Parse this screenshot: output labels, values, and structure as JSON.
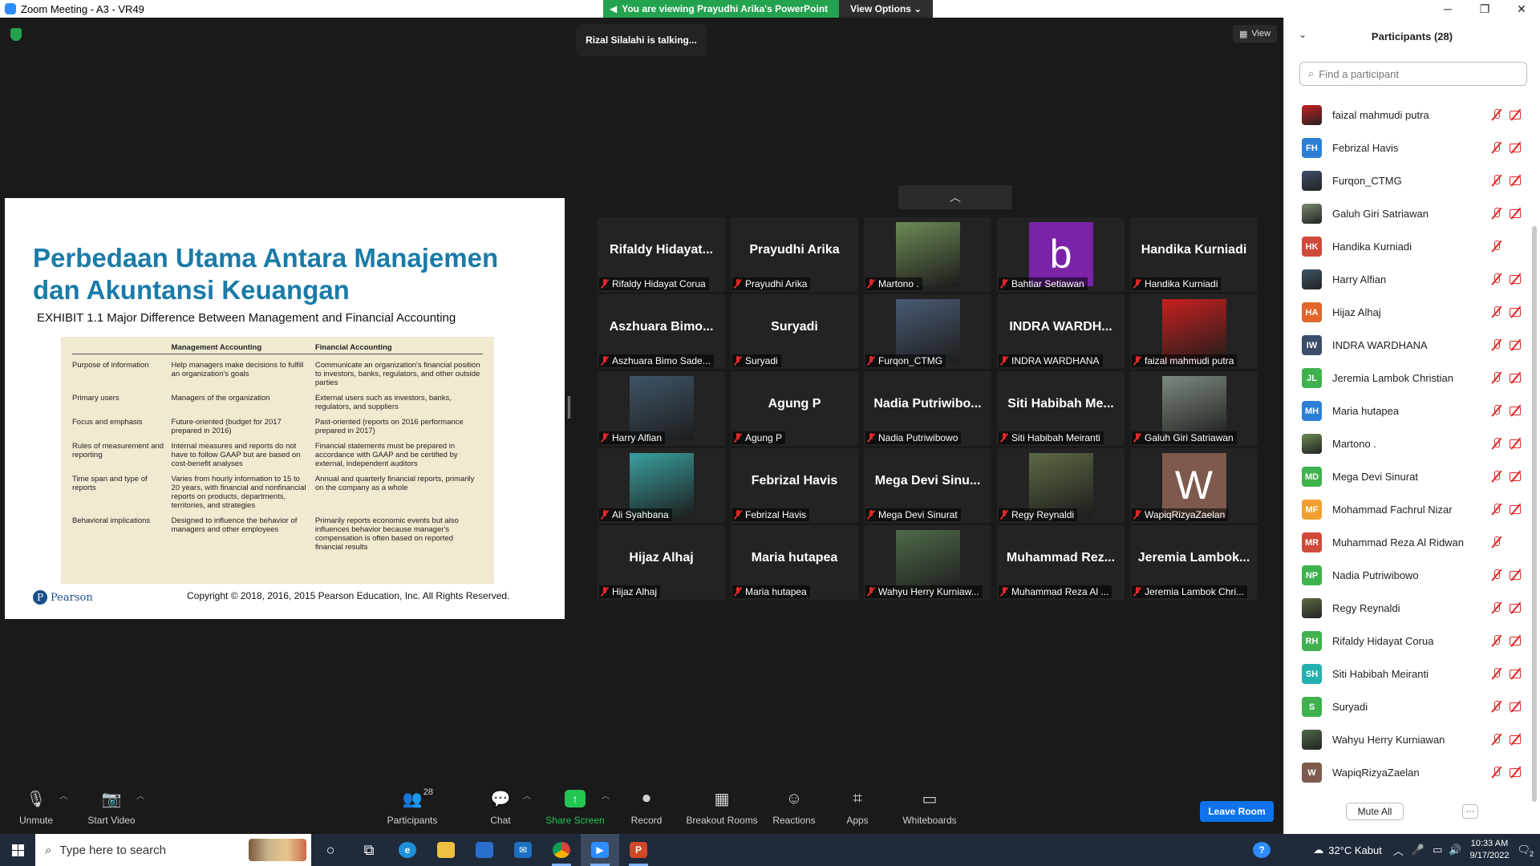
{
  "window": {
    "title": "Zoom Meeting - A3 - VR49",
    "controls": [
      "─",
      "❐",
      "✕"
    ]
  },
  "banner": {
    "viewing": "You are viewing Prayudhi Arika's PowerPoint",
    "view_options": "View Options ⌄"
  },
  "meeting": {
    "talking": "Rizal Silalahi is talking...",
    "view_label": "View"
  },
  "slide": {
    "title": "Perbedaan Utama Antara Manajemen dan Akuntansi Keuangan",
    "subtitle": "EXHIBIT 1.1 Major Difference Between Management and Financial Accounting",
    "columns": [
      "",
      "Management Accounting",
      "Financial Accounting"
    ],
    "rows": [
      [
        "Purpose of information",
        "Help managers make decisions to fulfill an organization's goals",
        "Communicate an organization's financial position to investors, banks, regulators, and other outside parties"
      ],
      [
        "Primary users",
        "Managers of the organization",
        "External users such as investors, banks, regulators, and suppliers"
      ],
      [
        "Focus and emphasis",
        "Future-oriented (budget for 2017 prepared in 2016)",
        "Past-oriented (reports on 2016 performance prepared in 2017)"
      ],
      [
        "Rules of measurement and reporting",
        "Internal measures and reports do not have to follow GAAP but are based on cost-benefit analyses",
        "Financial statements must be prepared in accordance with GAAP and be certified by external, independent auditors"
      ],
      [
        "Time span and type of reports",
        "Varies from hourly information to 15 to 20 years, with financial and nonfinancial reports on products, departments, territories, and strategies",
        "Annual and quarterly financial reports, primarily on the company as a whole"
      ],
      [
        "Behavioral implications",
        "Designed to influence the behavior of managers and other employees",
        "Primarily reports economic events but also influences behavior because manager's compensation is often based on reported financial results"
      ]
    ],
    "logo_text": "Pearson",
    "copyright": "Copyright © 2018, 2016, 2015 Pearson Education, Inc. All Rights Reserved."
  },
  "gallery": {
    "tiles": [
      {
        "display": "Rifaldy  Hidayat...",
        "label": "Rifaldy Hidayat Corua",
        "kind": "name"
      },
      {
        "display": "Prayudhi Arika",
        "label": "Prayudhi Arika",
        "kind": "name"
      },
      {
        "display": "",
        "label": "Martono .",
        "kind": "video",
        "color": "#6d8a55"
      },
      {
        "display": "b",
        "label": "Bahtiar Setiawan",
        "kind": "letter",
        "color": "#7a22a8"
      },
      {
        "display": "Handika Kurniadi",
        "label": "Handika Kurniadi",
        "kind": "name"
      },
      {
        "display": "Aszhuara  Bimo...",
        "label": "Aszhuara Bimo Sade...",
        "kind": "name"
      },
      {
        "display": "Suryadi",
        "label": "Suryadi",
        "kind": "name"
      },
      {
        "display": "",
        "label": "Furqon_CTMG",
        "kind": "video",
        "color": "#4a5b74"
      },
      {
        "display": "INDRA  WARDH...",
        "label": "INDRA WARDHANA",
        "kind": "name"
      },
      {
        "display": "",
        "label": "faizal mahmudi putra",
        "kind": "video",
        "color": "#c8201e"
      },
      {
        "display": "",
        "label": "Harry Alfian",
        "kind": "video",
        "color": "#3f5568"
      },
      {
        "display": "Agung P",
        "label": "Agung P",
        "kind": "name"
      },
      {
        "display": "Nadia  Putriwibo...",
        "label": "Nadia Putriwibowo",
        "kind": "name"
      },
      {
        "display": "Siti  Habibah  Me...",
        "label": "Siti Habibah Meiranti",
        "kind": "name"
      },
      {
        "display": "",
        "label": "Galuh Giri Satriawan",
        "kind": "video",
        "color": "#7d8a7e"
      },
      {
        "display": "",
        "label": "Ali Syahbana",
        "kind": "video",
        "color": "#3aa0a0"
      },
      {
        "display": "Febrizal Havis",
        "label": "Febrizal Havis",
        "kind": "name"
      },
      {
        "display": "Mega  Devi  Sinu...",
        "label": "Mega Devi Sinurat",
        "kind": "name"
      },
      {
        "display": "",
        "label": "Regy Reynaldi",
        "kind": "video",
        "color": "#5d6a45"
      },
      {
        "display": "W",
        "label": "WapiqRizyaZaelan",
        "kind": "letter",
        "color": "#7d5a4d"
      },
      {
        "display": "Hijaz Alhaj",
        "label": "Hijaz Alhaj",
        "kind": "name"
      },
      {
        "display": "Maria hutapea",
        "label": "Maria hutapea",
        "kind": "name"
      },
      {
        "display": "",
        "label": "Wahyu Herry Kurniaw...",
        "kind": "video",
        "color": "#4f6a4a"
      },
      {
        "display": "Muhammad  Rez...",
        "label": "Muhammad Reza Al ...",
        "kind": "name"
      },
      {
        "display": "Jeremia  Lambok...",
        "label": "Jeremia Lambok Chri...",
        "kind": "name"
      }
    ]
  },
  "toolbar": {
    "unmute": "Unmute",
    "start_video": "Start Video",
    "participants": "Participants",
    "participants_count": "28",
    "chat": "Chat",
    "share_screen": "Share Screen",
    "record": "Record",
    "breakout": "Breakout Rooms",
    "reactions": "Reactions",
    "apps": "Apps",
    "whiteboards": "Whiteboards",
    "leave": "Leave Room"
  },
  "panel": {
    "title": "Participants (28)",
    "search_placeholder": "Find a participant",
    "mute_all": "Mute All",
    "more": "···",
    "participants": [
      {
        "name": "faizal mahmudi putra",
        "initials": "",
        "color": "#c8201e",
        "video_off": true
      },
      {
        "name": "Febrizal Havis",
        "initials": "FH",
        "color": "#2d7fd6",
        "video_off": true
      },
      {
        "name": "Furqon_CTMG",
        "initials": "",
        "color": "#3f4f6a",
        "video_off": true
      },
      {
        "name": "Galuh Giri Satriawan",
        "initials": "",
        "color": "#7a8a6f",
        "video_off": true
      },
      {
        "name": "Handika Kurniadi",
        "initials": "HK",
        "color": "#d04a3a",
        "video_off": false
      },
      {
        "name": "Harry Alfian",
        "initials": "",
        "color": "#3f5568",
        "video_off": true
      },
      {
        "name": "Hijaz Alhaj",
        "initials": "HA",
        "color": "#e0662b",
        "video_off": true
      },
      {
        "name": "INDRA WARDHANA",
        "initials": "IW",
        "color": "#3a4e6a",
        "video_off": true
      },
      {
        "name": "Jeremia Lambok Christian",
        "initials": "JL",
        "color": "#3fb24f",
        "video_off": true
      },
      {
        "name": "Maria hutapea",
        "initials": "MH",
        "color": "#2d7fd6",
        "video_off": true
      },
      {
        "name": "Martono .",
        "initials": "",
        "color": "#6d8a55",
        "video_off": true
      },
      {
        "name": "Mega Devi Sinurat",
        "initials": "MD",
        "color": "#3fb24f",
        "video_off": true
      },
      {
        "name": "Mohammad Fachrul Nizar",
        "initials": "MF",
        "color": "#f0a030",
        "video_off": true
      },
      {
        "name": "Muhammad Reza Al Ridwan",
        "initials": "MR",
        "color": "#d04a3a",
        "video_off": false
      },
      {
        "name": "Nadia Putriwibowo",
        "initials": "NP",
        "color": "#3fb24f",
        "video_off": true
      },
      {
        "name": "Regy Reynaldi",
        "initials": "",
        "color": "#5d6a45",
        "video_off": true
      },
      {
        "name": "Rifaldy Hidayat Corua",
        "initials": "RH",
        "color": "#3fb24f",
        "video_off": true
      },
      {
        "name": "Siti Habibah Meiranti",
        "initials": "SH",
        "color": "#25b0b0",
        "video_off": true
      },
      {
        "name": "Suryadi",
        "initials": "S",
        "color": "#3fb24f",
        "video_off": true
      },
      {
        "name": "Wahyu Herry Kurniawan",
        "initials": "",
        "color": "#4f6a4a",
        "video_off": true
      },
      {
        "name": "WapiqRizyaZaelan",
        "initials": "W",
        "color": "#7d5a4d",
        "video_off": true
      }
    ]
  },
  "taskbar": {
    "search_placeholder": "Type here to search",
    "weather": "32°C  Kabut",
    "time": "10:33 AM",
    "date": "9/17/2022",
    "notifications": "2"
  }
}
